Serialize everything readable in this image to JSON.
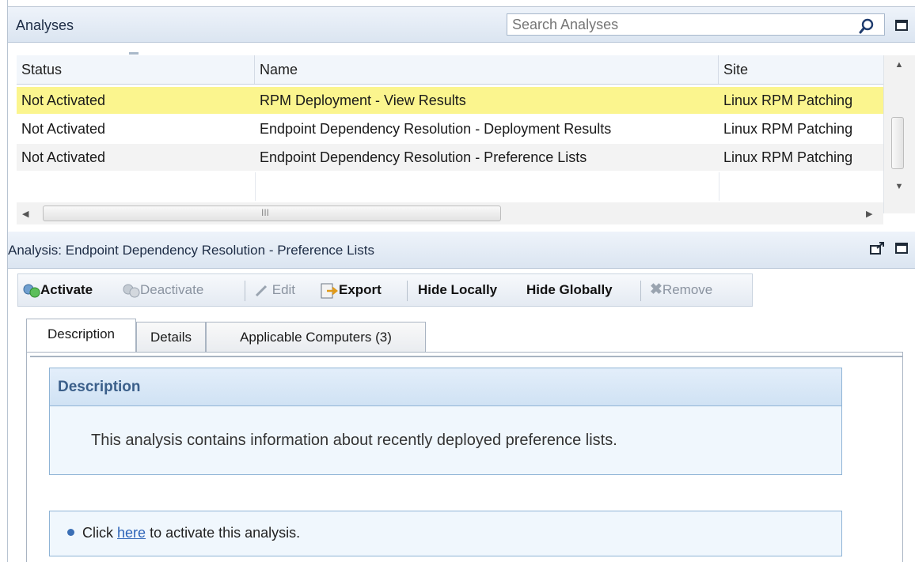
{
  "analyses_panel": {
    "title": "Analyses",
    "search_placeholder": "Search Analyses",
    "columns": [
      "Status",
      "Name",
      "Site"
    ],
    "rows": [
      {
        "status": "Not Activated",
        "name": "RPM Deployment - View Results",
        "site": "Linux RPM Patching",
        "selected": true
      },
      {
        "status": "Not Activated",
        "name": "Endpoint Dependency Resolution - Deployment Results",
        "site": "Linux RPM Patching",
        "selected": false
      },
      {
        "status": "Not Activated",
        "name": "Endpoint Dependency Resolution - Preference Lists",
        "site": "Linux RPM Patching",
        "selected": false
      }
    ],
    "scroll_marker": "III"
  },
  "detail_panel": {
    "title": "Analysis: Endpoint Dependency Resolution - Preference Lists",
    "toolbar": {
      "activate": "Activate",
      "deactivate": "Deactivate",
      "edit": "Edit",
      "export": "Export",
      "hide_locally": "Hide Locally",
      "hide_globally": "Hide Globally",
      "remove": "Remove"
    },
    "tabs": [
      "Description",
      "Details",
      "Applicable Computers (3)"
    ],
    "active_tab": "Description",
    "description": {
      "header": "Description",
      "text": "This analysis contains information about recently deployed preference lists."
    },
    "activate_hint": {
      "prefix": "Click",
      "link": "here",
      "suffix": "to activate this analysis."
    }
  },
  "colors": {
    "selection": "#fbf58e",
    "header_bg": "#dbe5f1",
    "link": "#2d64b8",
    "desc_title": "#3b5f8a"
  },
  "icons": [
    "search-icon",
    "maximize-icon",
    "popout-icon",
    "activate-icon",
    "deactivate-icon",
    "edit-icon",
    "export-icon",
    "remove-icon",
    "bullet-icon"
  ]
}
